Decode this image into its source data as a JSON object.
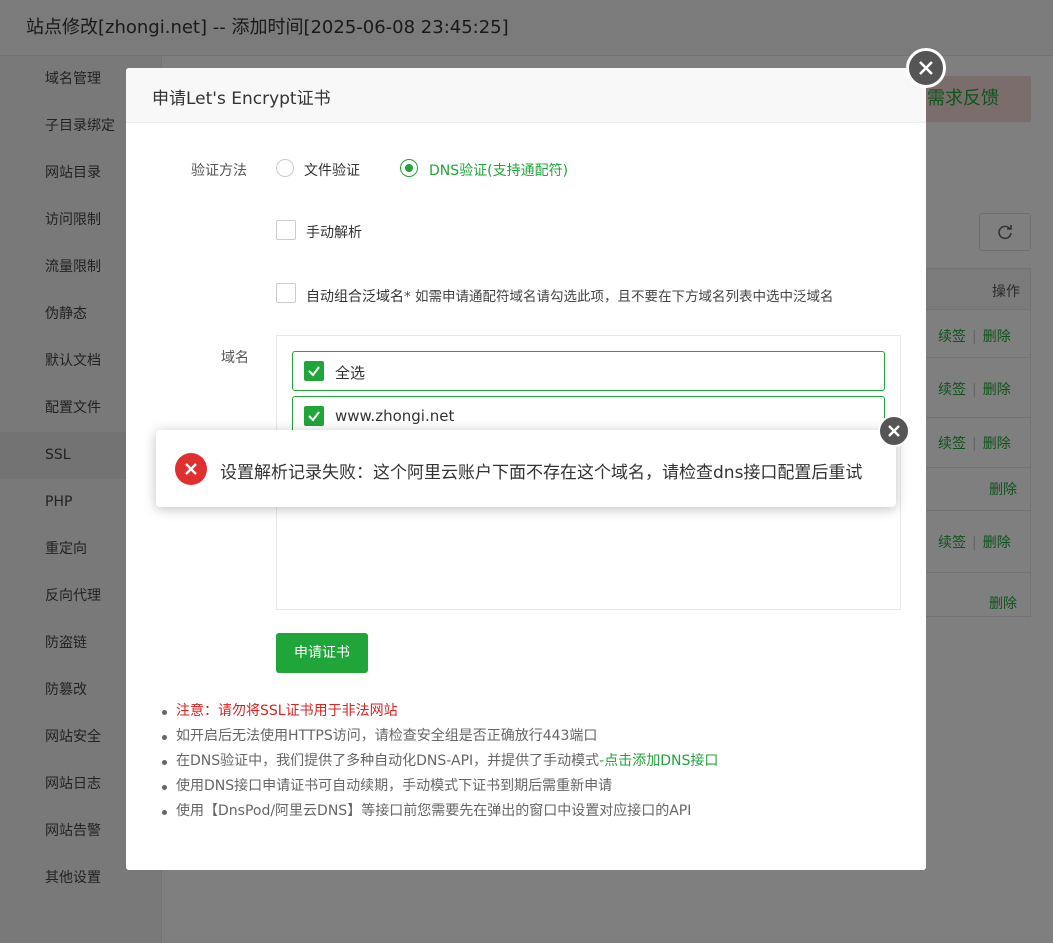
{
  "window": {
    "title": "站点修改[zhongi.net] -- 添加时间[2025-06-08 23:45:25]"
  },
  "sidebar": {
    "items": [
      {
        "label": "域名管理"
      },
      {
        "label": "子目录绑定"
      },
      {
        "label": "网站目录"
      },
      {
        "label": "访问限制"
      },
      {
        "label": "流量限制"
      },
      {
        "label": "伪静态"
      },
      {
        "label": "默认文档"
      },
      {
        "label": "配置文件"
      },
      {
        "label": "SSL"
      },
      {
        "label": "PHP"
      },
      {
        "label": "重定向"
      },
      {
        "label": "反向代理"
      },
      {
        "label": "防盗链"
      },
      {
        "label": "防篡改"
      },
      {
        "label": "网站安全"
      },
      {
        "label": "网站日志"
      },
      {
        "label": "网站告警"
      },
      {
        "label": "其他设置"
      }
    ],
    "active": "SSL"
  },
  "background": {
    "feedback_label": "需求反馈",
    "table_header_action": "操作",
    "row_actions": {
      "renew": "续签",
      "delete": "删除"
    }
  },
  "modal": {
    "title": "申请Let's Encrypt证书",
    "verify_label": "验证方法",
    "verify_options": [
      {
        "label": "文件验证",
        "selected": false
      },
      {
        "label": "DNS验证(支持通配符)",
        "selected": true
      }
    ],
    "manual_resolve_label": "手动解析",
    "manual_resolve_checked": false,
    "auto_wildcard_label": "自动组合泛域名",
    "auto_wildcard_hint": "* 如需申请通配符域名请勾选此项，且不要在下方域名列表中选中泛域名",
    "auto_wildcard_checked": false,
    "domain_label": "域名",
    "domains": [
      {
        "label": "全选",
        "checked": true
      },
      {
        "label": "www.zhongi.net",
        "checked": true
      }
    ],
    "apply_button": "申请证书",
    "notes": [
      {
        "text": "注意：请勿将SSL证书用于非法网站"
      },
      {
        "text": "如开启后无法使用HTTPS访问，请检查安全组是否正确放行443端口"
      },
      {
        "text": "在DNS验证中，我们提供了多种自动化DNS-API，并提供了手动模式",
        "link": "-点击添加DNS接口"
      },
      {
        "text": "使用DNS接口申请证书可自动续期，手动模式下证书到期后需重新申请"
      },
      {
        "text": "使用【DnsPod/阿里云DNS】等接口前您需要先在弹出的窗口中设置对应接口的API"
      }
    ]
  },
  "toast": {
    "message": "设置解析记录失败：这个阿里云账户下面不存在这个域名，请检查dns接口配置后重试",
    "type": "error"
  },
  "colors": {
    "accent": "#20a53a",
    "error": "#e02f2f",
    "warning_text": "#e02020"
  }
}
